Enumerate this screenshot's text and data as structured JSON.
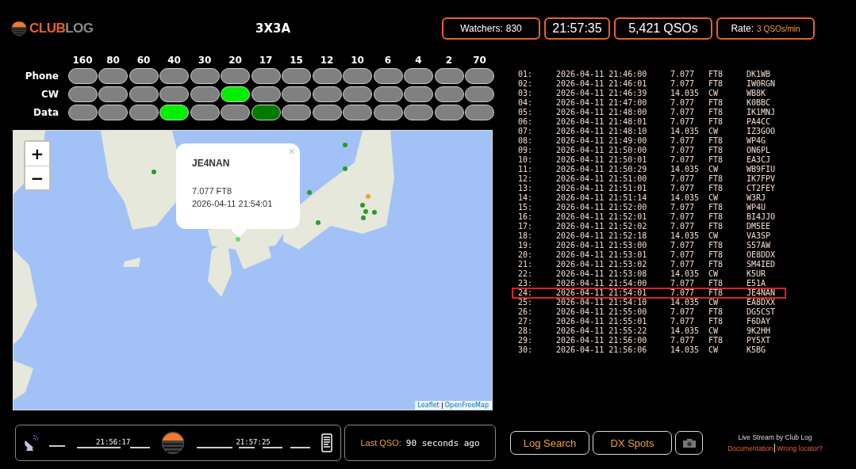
{
  "logo_text": [
    "CLUB",
    "LOG"
  ],
  "title": "3X3A",
  "stats": [
    {
      "kind": "text",
      "label": "Watchers:",
      "value": "830"
    },
    {
      "kind": "clock",
      "value": "21:57:35"
    },
    {
      "kind": "count",
      "value": "5,421",
      "label": "QSOs"
    },
    {
      "kind": "rate",
      "label": "Rate:",
      "value": "3 QSOs/min"
    }
  ],
  "bands": [
    "160",
    "80",
    "60",
    "40",
    "30",
    "20",
    "17",
    "15",
    "12",
    "10",
    "6",
    "4",
    "2",
    "70"
  ],
  "band_modes": [
    {
      "mode": "Phone",
      "cells": [
        {
          "color": "#808080"
        },
        {
          "color": "#808080"
        },
        {
          "color": "#808080"
        },
        {
          "color": "#808080"
        },
        {
          "color": "#808080"
        },
        {
          "color": "#808080"
        },
        {
          "color": "#808080"
        },
        {
          "color": "#808080"
        },
        {
          "color": "#808080"
        },
        {
          "color": "#808080"
        },
        {
          "color": "#808080"
        },
        {
          "color": "#808080"
        },
        {
          "color": "#808080"
        },
        {
          "color": "#808080"
        }
      ]
    },
    {
      "mode": "CW",
      "cells": [
        {
          "color": "#808080"
        },
        {
          "color": "#808080"
        },
        {
          "color": "#808080"
        },
        {
          "color": "#808080"
        },
        {
          "color": "#808080"
        },
        {
          "color": "#00ee00"
        },
        {
          "color": "#808080"
        },
        {
          "color": "#808080"
        },
        {
          "color": "#808080"
        },
        {
          "color": "#808080"
        },
        {
          "color": "#808080"
        },
        {
          "color": "#808080"
        },
        {
          "color": "#808080"
        },
        {
          "color": "#808080"
        }
      ]
    },
    {
      "mode": "Data",
      "cells": [
        {
          "color": "#808080"
        },
        {
          "color": "#808080"
        },
        {
          "color": "#808080"
        },
        {
          "color": "#00ee00"
        },
        {
          "color": "#808080"
        },
        {
          "color": "#808080"
        },
        {
          "color": "#007a00"
        },
        {
          "color": "#808080"
        },
        {
          "color": "#808080"
        },
        {
          "color": "#808080"
        },
        {
          "color": "#808080"
        },
        {
          "color": "#808080"
        },
        {
          "color": "#808080"
        },
        {
          "color": "#808080"
        }
      ]
    }
  ],
  "map": {
    "zoom_in": "+",
    "zoom_out": "−",
    "popup": {
      "call": "JE4NAN",
      "freq_mode": "7.077 FT8",
      "time": "2026-04-11 21:54:01",
      "close": "×"
    },
    "attribution": [
      "Leaflet",
      "OpenFreeMap"
    ]
  },
  "log": [
    {
      "n": "01:",
      "time": "2026-04-11 21:46:00",
      "freq": "7.077",
      "mode": "FT8",
      "call": "DK1WB",
      "selected": false
    },
    {
      "n": "02:",
      "time": "2026-04-11 21:46:01",
      "freq": "7.077",
      "mode": "FT8",
      "call": "IW0RGN",
      "selected": false
    },
    {
      "n": "03:",
      "time": "2026-04-11 21:46:39",
      "freq": "14.035",
      "mode": "CW",
      "call": "WB8K",
      "selected": false
    },
    {
      "n": "04:",
      "time": "2026-04-11 21:47:00",
      "freq": "7.077",
      "mode": "FT8",
      "call": "K0BBC",
      "selected": false
    },
    {
      "n": "05:",
      "time": "2026-04-11 21:48:00",
      "freq": "7.077",
      "mode": "FT8",
      "call": "IK1MNJ",
      "selected": false
    },
    {
      "n": "06:",
      "time": "2026-04-11 21:48:01",
      "freq": "7.077",
      "mode": "FT8",
      "call": "PA4CC",
      "selected": false
    },
    {
      "n": "07:",
      "time": "2026-04-11 21:48:10",
      "freq": "14.035",
      "mode": "CW",
      "call": "IZ3GOO",
      "selected": false
    },
    {
      "n": "08:",
      "time": "2026-04-11 21:49:00",
      "freq": "7.077",
      "mode": "FT8",
      "call": "WP4G",
      "selected": false
    },
    {
      "n": "09:",
      "time": "2026-04-11 21:50:00",
      "freq": "7.077",
      "mode": "FT8",
      "call": "ON6PL",
      "selected": false
    },
    {
      "n": "10:",
      "time": "2026-04-11 21:50:01",
      "freq": "7.077",
      "mode": "FT8",
      "call": "EA3CJ",
      "selected": false
    },
    {
      "n": "11:",
      "time": "2026-04-11 21:50:29",
      "freq": "14.035",
      "mode": "CW",
      "call": "WB9FIU",
      "selected": false
    },
    {
      "n": "12:",
      "time": "2026-04-11 21:51:00",
      "freq": "7.077",
      "mode": "FT8",
      "call": "IK7FPV",
      "selected": false
    },
    {
      "n": "13:",
      "time": "2026-04-11 21:51:01",
      "freq": "7.077",
      "mode": "FT8",
      "call": "CT2FEY",
      "selected": false
    },
    {
      "n": "14:",
      "time": "2026-04-11 21:51:14",
      "freq": "14.035",
      "mode": "CW",
      "call": "W3RJ",
      "selected": false
    },
    {
      "n": "15:",
      "time": "2026-04-11 21:52:00",
      "freq": "7.077",
      "mode": "FT8",
      "call": "WP4U",
      "selected": false
    },
    {
      "n": "16:",
      "time": "2026-04-11 21:52:01",
      "freq": "7.077",
      "mode": "FT8",
      "call": "BI4JJO",
      "selected": false
    },
    {
      "n": "17:",
      "time": "2026-04-11 21:52:02",
      "freq": "7.077",
      "mode": "FT8",
      "call": "DM5EE",
      "selected": false
    },
    {
      "n": "18:",
      "time": "2026-04-11 21:52:18",
      "freq": "14.035",
      "mode": "CW",
      "call": "VA3SP",
      "selected": false
    },
    {
      "n": "19:",
      "time": "2026-04-11 21:53:00",
      "freq": "7.077",
      "mode": "FT8",
      "call": "S57AW",
      "selected": false
    },
    {
      "n": "20:",
      "time": "2026-04-11 21:53:01",
      "freq": "7.077",
      "mode": "FT8",
      "call": "OE8DDX",
      "selected": false
    },
    {
      "n": "21:",
      "time": "2026-04-11 21:53:02",
      "freq": "7.077",
      "mode": "FT8",
      "call": "SM4IED",
      "selected": false
    },
    {
      "n": "22:",
      "time": "2026-04-11 21:53:08",
      "freq": "14.035",
      "mode": "CW",
      "call": "K5UR",
      "selected": false
    },
    {
      "n": "23:",
      "time": "2026-04-11 21:54:00",
      "freq": "7.077",
      "mode": "FT8",
      "call": "E51A",
      "selected": false
    },
    {
      "n": "24:",
      "time": "2026-04-11 21:54:01",
      "freq": "7.077",
      "mode": "FT8",
      "call": "JE4NAN",
      "selected": true
    },
    {
      "n": "25:",
      "time": "2026-04-11 21:54:10",
      "freq": "14.035",
      "mode": "CW",
      "call": "EA8DXX",
      "selected": false
    },
    {
      "n": "26:",
      "time": "2026-04-11 21:55:00",
      "freq": "7.077",
      "mode": "FT8",
      "call": "DG5CST",
      "selected": false
    },
    {
      "n": "27:",
      "time": "2026-04-11 21:55:01",
      "freq": "7.077",
      "mode": "FT8",
      "call": "F6DAY",
      "selected": false
    },
    {
      "n": "28:",
      "time": "2026-04-11 21:55:22",
      "freq": "14.035",
      "mode": "CW",
      "call": "9K2HH",
      "selected": false
    },
    {
      "n": "29:",
      "time": "2026-04-11 21:56:00",
      "freq": "7.077",
      "mode": "FT8",
      "call": "PY5XT",
      "selected": false
    },
    {
      "n": "30:",
      "time": "2026-04-11 21:56:06",
      "freq": "14.035",
      "mode": "CW",
      "call": "K5BG",
      "selected": false
    }
  ],
  "timeline": {
    "start": "21:56:17",
    "end": "21:57:25"
  },
  "last_qso": {
    "label": "Last QSO:",
    "value": "90 seconds ago"
  },
  "buttons": [
    "Log Search",
    "DX Spots"
  ],
  "footer": {
    "text": "Live Stream by Club Log",
    "links": [
      "Documentation",
      "Wrong locator?"
    ]
  }
}
